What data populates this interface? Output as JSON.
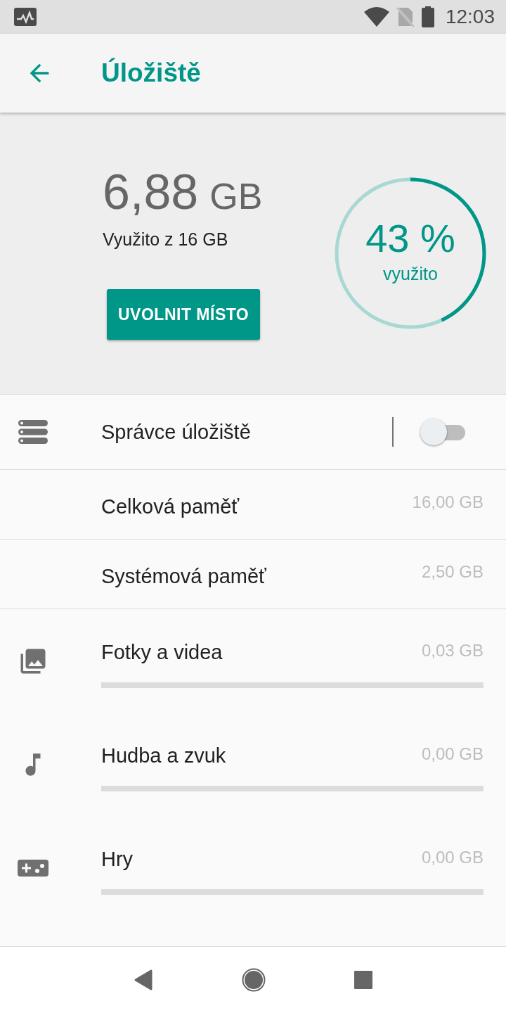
{
  "status_bar": {
    "time": "12:03"
  },
  "app_bar": {
    "title": "Úložiště"
  },
  "summary": {
    "used_amount": "6,88",
    "used_unit": "GB",
    "used_of": "Využito z 16 GB",
    "free_button": "UVOLNIT MÍSTO",
    "percent": "43 %",
    "percent_label": "využito"
  },
  "manager": {
    "label": "Správce úložiště",
    "on": false
  },
  "info_rows": [
    {
      "label": "Celková paměť",
      "value": "16,00 GB"
    },
    {
      "label": "Systémová paměť",
      "value": "2,50 GB"
    }
  ],
  "categories": [
    {
      "kind": "photos",
      "label": "Fotky a videa",
      "value": "0,03 GB"
    },
    {
      "kind": "music",
      "label": "Hudba a zvuk",
      "value": "0,00 GB"
    },
    {
      "kind": "games",
      "label": "Hry",
      "value": "0,00 GB"
    }
  ]
}
